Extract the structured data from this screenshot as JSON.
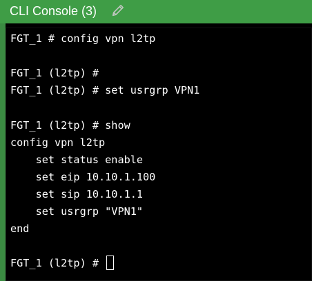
{
  "window": {
    "title": "CLI Console (3)",
    "title_bar_color": "#3f9d46",
    "edit_icon": "pencil-icon"
  },
  "terminal": {
    "background": "#000000",
    "foreground": "#ffffff",
    "lines": [
      "FGT_1 # config vpn l2tp",
      "",
      "FGT_1 (l2tp) #",
      "FGT_1 (l2tp) # set usrgrp VPN1",
      "",
      "FGT_1 (l2tp) # show",
      "config vpn l2tp",
      "    set status enable",
      "    set eip 10.10.1.100",
      "    set sip 10.10.1.1",
      "    set usrgrp \"VPN1\"",
      "end",
      "",
      "FGT_1 (l2tp) # "
    ]
  }
}
